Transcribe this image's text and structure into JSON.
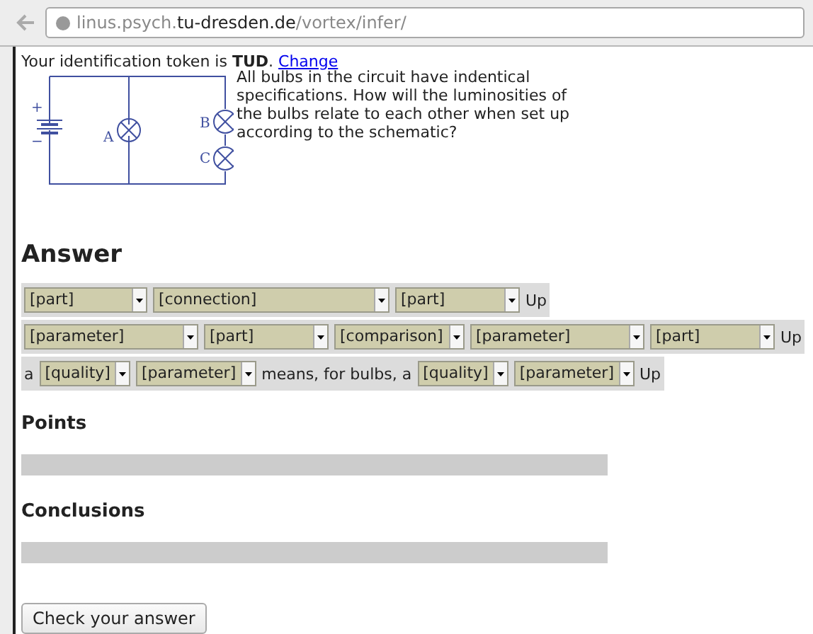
{
  "address_bar": {
    "host_prefix": "linus.psych.",
    "domain": "tu-dresden.de",
    "path": "/vortex/infer/"
  },
  "token_line": {
    "text": "Your identification token is **TUD**.",
    "link": "Change"
  },
  "schematic": {
    "plus": "+",
    "minus": "−",
    "bulb_labels": [
      "A",
      "B",
      "C"
    ]
  },
  "question": "All bulbs in the circuit have indentical specifications. How will the luminosities of the bulbs relate to each other when set up according to the schematic?",
  "answer_heading": "Answer",
  "answer_rows": [
    {
      "items": [
        {
          "kind": "select",
          "value": "[part]"
        },
        {
          "kind": "select",
          "value": "[connection]"
        },
        {
          "kind": "select",
          "value": "[part]"
        }
      ],
      "up": "Up"
    },
    {
      "items": [
        {
          "kind": "select",
          "value": "[parameter]"
        },
        {
          "kind": "select",
          "value": "[part]"
        },
        {
          "kind": "select",
          "value": "[comparison]"
        },
        {
          "kind": "select",
          "value": "[parameter]"
        },
        {
          "kind": "select",
          "value": "[part]"
        }
      ],
      "up": "Up"
    },
    {
      "items": [
        {
          "kind": "text",
          "value": "a"
        },
        {
          "kind": "select",
          "value": "[quality]"
        },
        {
          "kind": "select",
          "value": "[parameter]"
        },
        {
          "kind": "text",
          "value": "means, for bulbs, a"
        },
        {
          "kind": "select",
          "value": "[quality]"
        },
        {
          "kind": "select",
          "value": "[parameter]"
        }
      ],
      "up": "Up"
    }
  ],
  "sections": [
    {
      "heading": "Points"
    },
    {
      "heading": "Conclusions"
    }
  ],
  "check_button": "Check your answer"
}
